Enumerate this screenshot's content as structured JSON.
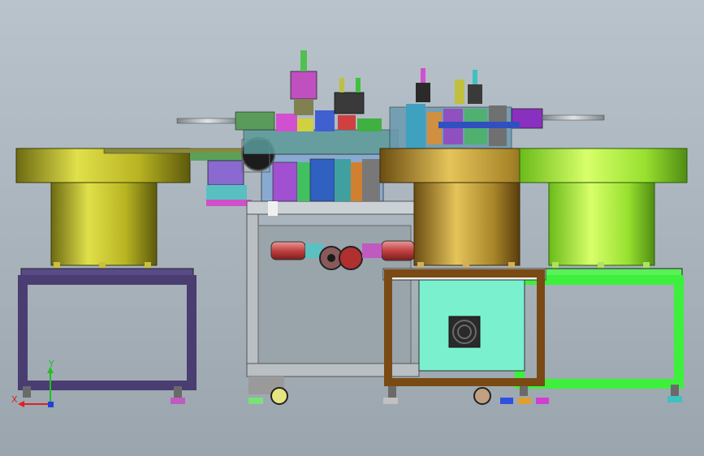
{
  "viewport": {
    "background_top": "#b9c3cc",
    "background_bottom": "#9aa5ae"
  },
  "triad": {
    "x_label": "X",
    "y_label": "Y",
    "x_color": "#e02020",
    "y_color": "#20c020",
    "z_color": "#2040e0"
  },
  "colors": {
    "left_bowl": "#bdbd2a",
    "center_bowl": "#b99a2a",
    "right_bowl": "#a6e02a",
    "left_stand": "#4a3d72",
    "center_frame": "#b8bfc5",
    "right_stand_brown": "#7a4a14",
    "right_stand_green": "#3cf03c",
    "control_box": "#7af0cf"
  }
}
